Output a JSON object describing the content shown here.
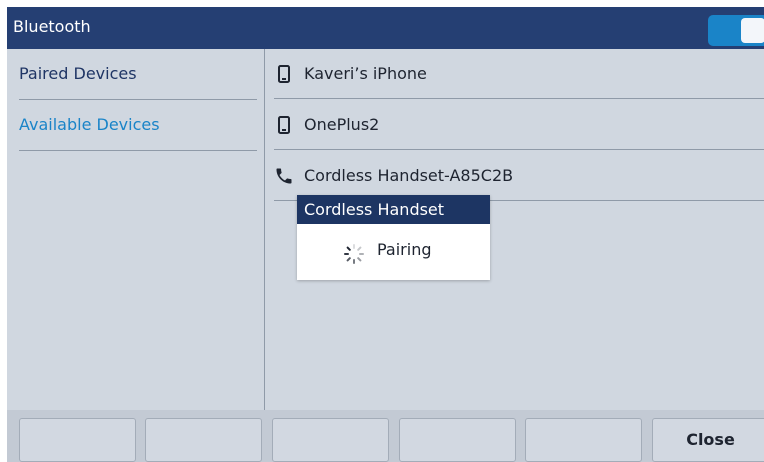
{
  "header": {
    "title": "Bluetooth",
    "toggle_state": "on"
  },
  "nav": {
    "items": [
      {
        "label": "Paired Devices"
      },
      {
        "label": "Available Devices"
      }
    ]
  },
  "devices": [
    {
      "name": "Kaveri’s iPhone",
      "icon": "mobile-phone-icon"
    },
    {
      "name": "OnePlus2",
      "icon": "mobile-phone-icon"
    },
    {
      "name": "Cordless Handset-A85C2B",
      "icon": "handset-icon"
    }
  ],
  "popup": {
    "title": "Cordless Handset",
    "message": "Pairing",
    "icon": "loading-spinner-icon"
  },
  "softkeys": {
    "labels": [
      "",
      "",
      "",
      "",
      "",
      "Close"
    ]
  },
  "colors": {
    "title_bar": "#253f73",
    "accent": "#1a84c8",
    "popup_header": "#1d3563",
    "background": "#d0d7e0"
  }
}
